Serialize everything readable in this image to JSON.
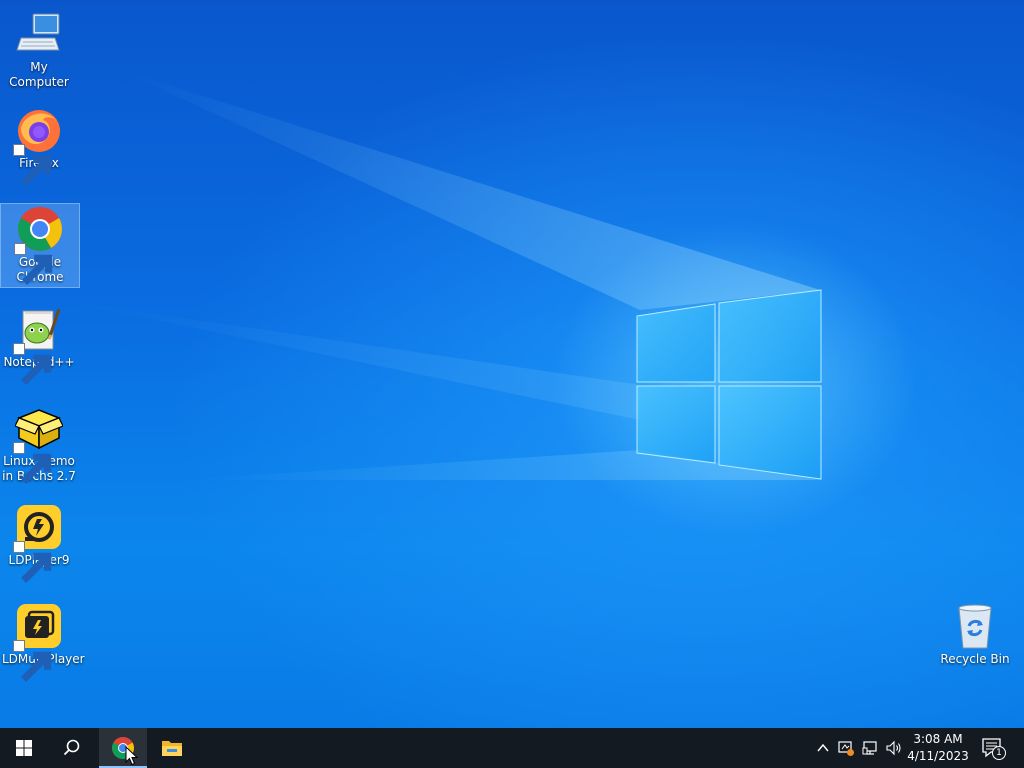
{
  "desktop": {
    "icons": [
      {
        "label": "My Computer"
      },
      {
        "label": "Firefox"
      },
      {
        "label": "Google Chrome"
      },
      {
        "label": "Notepad++"
      },
      {
        "label": "Linux Demo in Bochs 2.7"
      },
      {
        "label": "LDPlayer9"
      },
      {
        "label": "LDMultiPlayer"
      },
      {
        "label": "Recycle Bin"
      }
    ]
  },
  "taskbar": {
    "clock_time": "3:08 AM",
    "clock_date": "4/11/2023",
    "notification_count": "1"
  },
  "colors": {
    "taskbar": "#141a22",
    "wallpaper_blue": "#0a6be0"
  }
}
